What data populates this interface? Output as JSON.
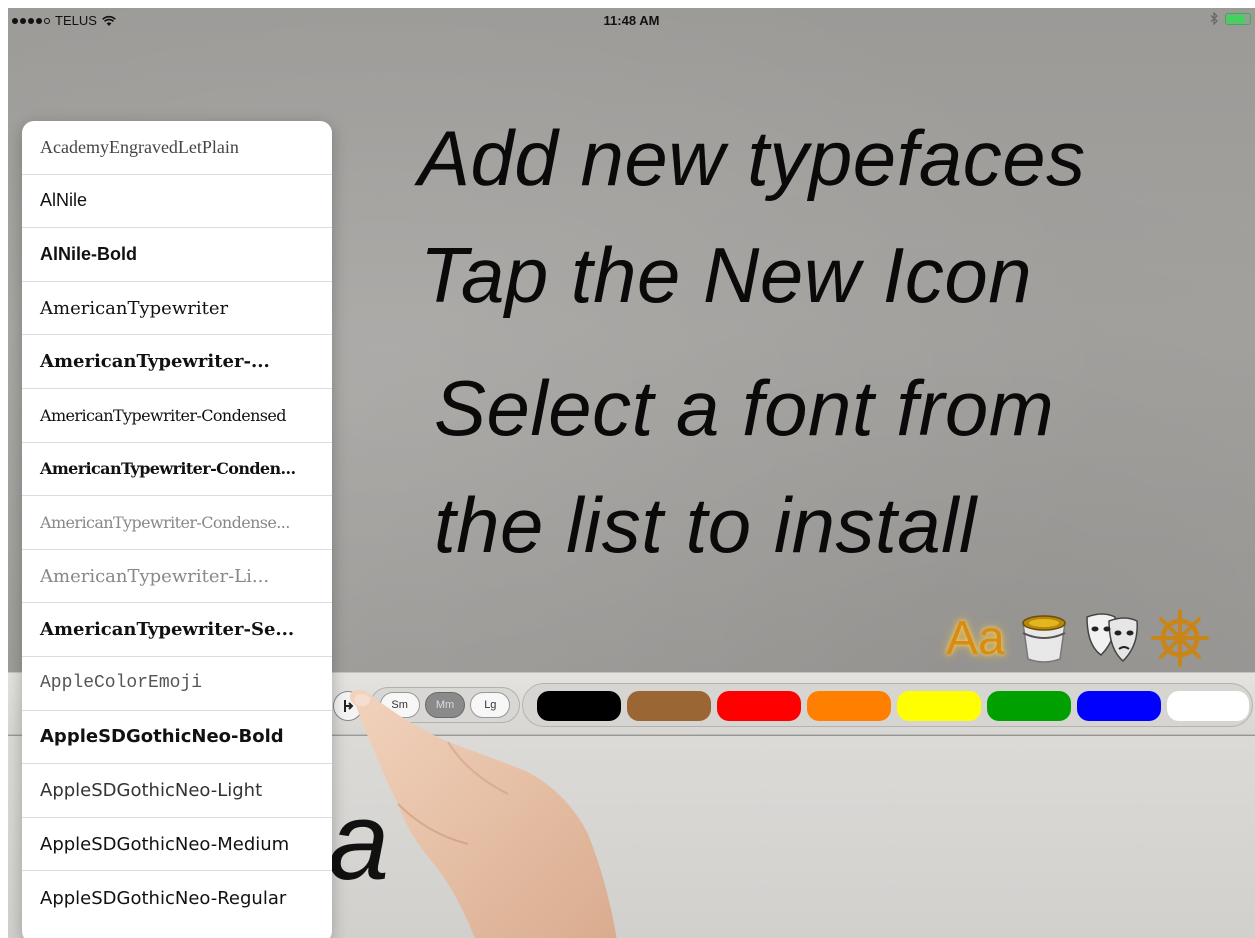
{
  "status_bar": {
    "carrier": "TELUS",
    "time": "11:48 AM"
  },
  "instructions": [
    "Add new typefaces",
    "Tap the New Icon",
    "Select a font from",
    "the list to install"
  ],
  "tool_icons": {
    "text_tool_label": "Aa",
    "icons": [
      "paint-bucket-icon",
      "theater-masks-icon",
      "ship-wheel-icon"
    ]
  },
  "size_buttons": [
    {
      "label": "Sm",
      "active": false
    },
    {
      "label": "Mm",
      "active": true
    },
    {
      "label": "Lg",
      "active": false
    }
  ],
  "color_swatches": [
    "#000000",
    "#9a6633",
    "#ff0000",
    "#ff8000",
    "#ffff00",
    "#00a000",
    "#0000ff",
    "#ffffff"
  ],
  "canvas_text": "a",
  "font_list": [
    "AcademyEngravedLetPlain",
    "AlNile",
    "AlNile-Bold",
    "AmericanTypewriter",
    "AmericanTypewriter-...",
    "AmericanTypewriter-Condensed",
    "AmericanTypewriter-Conden...",
    "AmericanTypewriter-Condense...",
    "AmericanTypewriter-Li...",
    "AmericanTypewriter-Se...",
    "AppleColorEmoji",
    "AppleSDGothicNeo-Bold",
    "AppleSDGothicNeo-Light",
    "AppleSDGothicNeo-Medium",
    "AppleSDGothicNeo-Regular"
  ]
}
